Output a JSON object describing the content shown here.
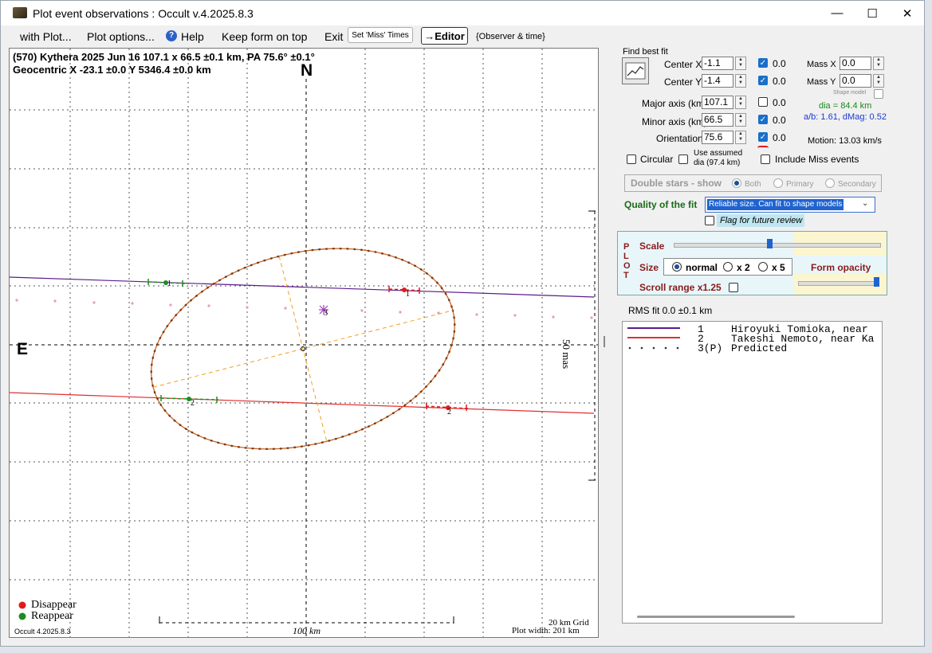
{
  "window": {
    "title": "Plot event observations : Occult v.4.2025.8.3",
    "minimize_glyph": "—",
    "maximize_glyph": "☐",
    "close_glyph": "✕"
  },
  "menu": {
    "with_plot": "with Plot...",
    "plot_options": "Plot options...",
    "help": "Help",
    "keep_on_top": "Keep form on top",
    "exit": "Exit",
    "set_miss_times": "Set 'Miss' Times",
    "editor": "→Editor",
    "observer_time": "{Observer & time}"
  },
  "plot": {
    "header_line1": "(570) Kythera  2025 Jun 16  107.1 x 66.5 ±0.1 km, PA 75.6° ±0.1°",
    "header_line2": "Geocentric  X  -23.1 ±0.0  Y 5346.4 ±0.0 km",
    "north": "N",
    "east": "E",
    "scale_mas": "50 mas",
    "scale_km": "100 km",
    "grid_label": "20 km Grid",
    "plot_width": "Plot width: 201 km",
    "version": "Occult 4.2025.8.3",
    "legend_disappear": "Disappear",
    "legend_reappear": "Reappear",
    "chord_label_1": "1",
    "chord_label_2": "2",
    "chord_label_3": "3",
    "colors": {
      "chord1": "#5b1b8c",
      "chord2": "#e03030",
      "ellipse": "#c8642a",
      "predicted": "#e79ac0",
      "disappear": "#e01b1b",
      "reappear": "#1f8c1f"
    }
  },
  "fit": {
    "find_best_fit": "Find best fit",
    "center_x_label": "Center X",
    "center_x": "-1.1",
    "center_x_unc": "0.0",
    "center_y_label": "Center Y",
    "center_y": "-1.4",
    "center_y_unc": "0.0",
    "mass_x_label": "Mass X",
    "mass_x": "0.0",
    "mass_y_label": "Mass Y",
    "mass_y": "0.0",
    "shape_model": "Shape model",
    "major_label": "Major axis (km)",
    "major": "107.1",
    "major_unc": "0.0",
    "minor_label": "Minor axis (km)",
    "minor": "66.5",
    "minor_unc": "0.0",
    "orient_label": "Orientation",
    "orient": "75.6",
    "orient_unc": "0.0",
    "dia": "dia = 84.4 km",
    "ab": "a/b: 1.61, dMag: 0.52",
    "motion": "Motion: 13.03 km/s",
    "circular": "Circular",
    "use_assumed": "Use assumed",
    "use_assumed_2": "dia (97.4 km)",
    "include_miss": "Include Miss events",
    "double_stars": "Double stars - show",
    "both": "Both",
    "primary": "Primary",
    "secondary": "Secondary",
    "quality_label": "Quality of the fit",
    "quality_value": "Reliable size. Can fit to shape models",
    "flag_review": "Flag for future review"
  },
  "plotpanel": {
    "vertical": "PLOT",
    "scale": "Scale",
    "size": "Size",
    "normal": "normal",
    "x2": "x 2",
    "x5": "x 5",
    "form_opacity": "Form opacity",
    "scroll_range": "Scroll range x1.25"
  },
  "rms": "RMS fit 0.0 ±0.1 km",
  "observers": [
    {
      "num": "1",
      "name": "Hiroyuki Tomioka, near"
    },
    {
      "num": "2",
      "name": "Takeshi Nemoto, near Ka"
    },
    {
      "num": "3(P)",
      "name": "Predicted"
    }
  ]
}
